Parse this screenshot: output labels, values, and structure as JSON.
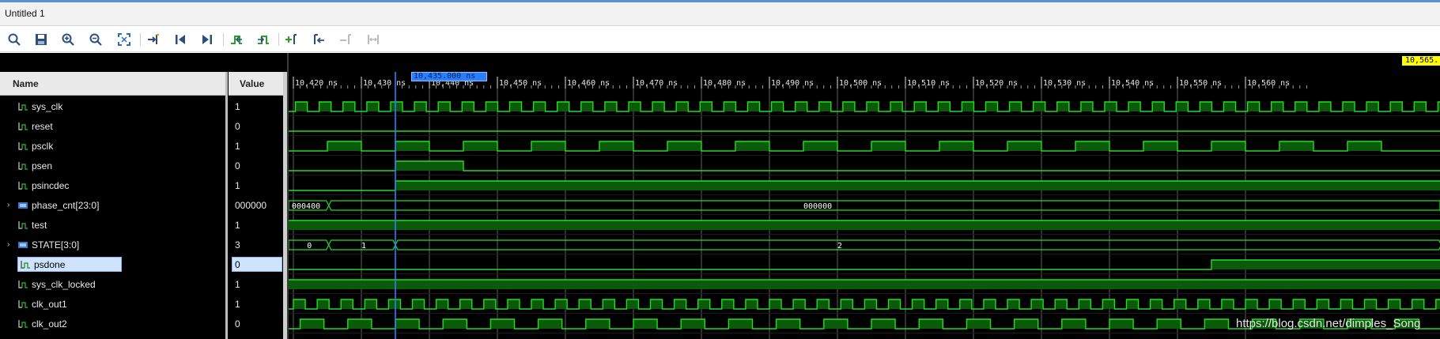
{
  "window": {
    "title": "Untitled 1"
  },
  "toolbar": {
    "icons": [
      "search-icon",
      "save-icon",
      "zoom-in-icon",
      "zoom-out-icon",
      "zoom-fit-icon",
      "goto-cursor-icon",
      "goto-start-icon",
      "goto-end-icon",
      "prev-transition-icon",
      "next-transition-icon",
      "add-marker-icon",
      "prev-marker-icon",
      "next-marker-icon",
      "swap-cursors-icon"
    ]
  },
  "columns": {
    "name": "Name",
    "value": "Value"
  },
  "signals": [
    {
      "name": "sys_clk",
      "value": "1",
      "expandable": false,
      "bus": false
    },
    {
      "name": "reset",
      "value": "0",
      "expandable": false,
      "bus": false
    },
    {
      "name": "psclk",
      "value": "1",
      "expandable": false,
      "bus": false
    },
    {
      "name": "psen",
      "value": "0",
      "expandable": false,
      "bus": false
    },
    {
      "name": "psincdec",
      "value": "1",
      "expandable": false,
      "bus": false
    },
    {
      "name": "phase_cnt[23:0]",
      "value": "000000",
      "expandable": true,
      "bus": true
    },
    {
      "name": "test",
      "value": "1",
      "expandable": false,
      "bus": false
    },
    {
      "name": "STATE[3:0]",
      "value": "3",
      "expandable": true,
      "bus": true
    },
    {
      "name": "psdone",
      "value": "0",
      "expandable": false,
      "bus": false,
      "selected": true
    },
    {
      "name": "sys_clk_locked",
      "value": "1",
      "expandable": false,
      "bus": false
    },
    {
      "name": "clk_out1",
      "value": "1",
      "expandable": false,
      "bus": false
    },
    {
      "name": "clk_out2",
      "value": "0",
      "expandable": false,
      "bus": false
    }
  ],
  "timeline": {
    "ticks": [
      "10,420 ns",
      "10,430 ns",
      "10,440 ns",
      "10,450 ns",
      "10,460 ns",
      "10,470 ns",
      "10,480 ns",
      "10,490 ns",
      "10,500 ns",
      "10,510 ns",
      "10,520 ns",
      "10,530 ns",
      "10,540 ns",
      "10,550 ns",
      "10,560 ns"
    ],
    "cursor_label": "10,435.000 ns",
    "marker_label": "10,565."
  },
  "bus_labels": {
    "phase_before": "000400",
    "phase_after": "000000",
    "state_0": "0",
    "state_1": "1",
    "state_2": "2"
  },
  "colors": {
    "wave": "#22dd22",
    "wave_fill": "#0a5a0a",
    "cursor": "#2a7fff",
    "marker": "#ffff00",
    "grid": "#c8c8c8"
  },
  "watermark": "https://blog.csdn.net/dimples_Song"
}
